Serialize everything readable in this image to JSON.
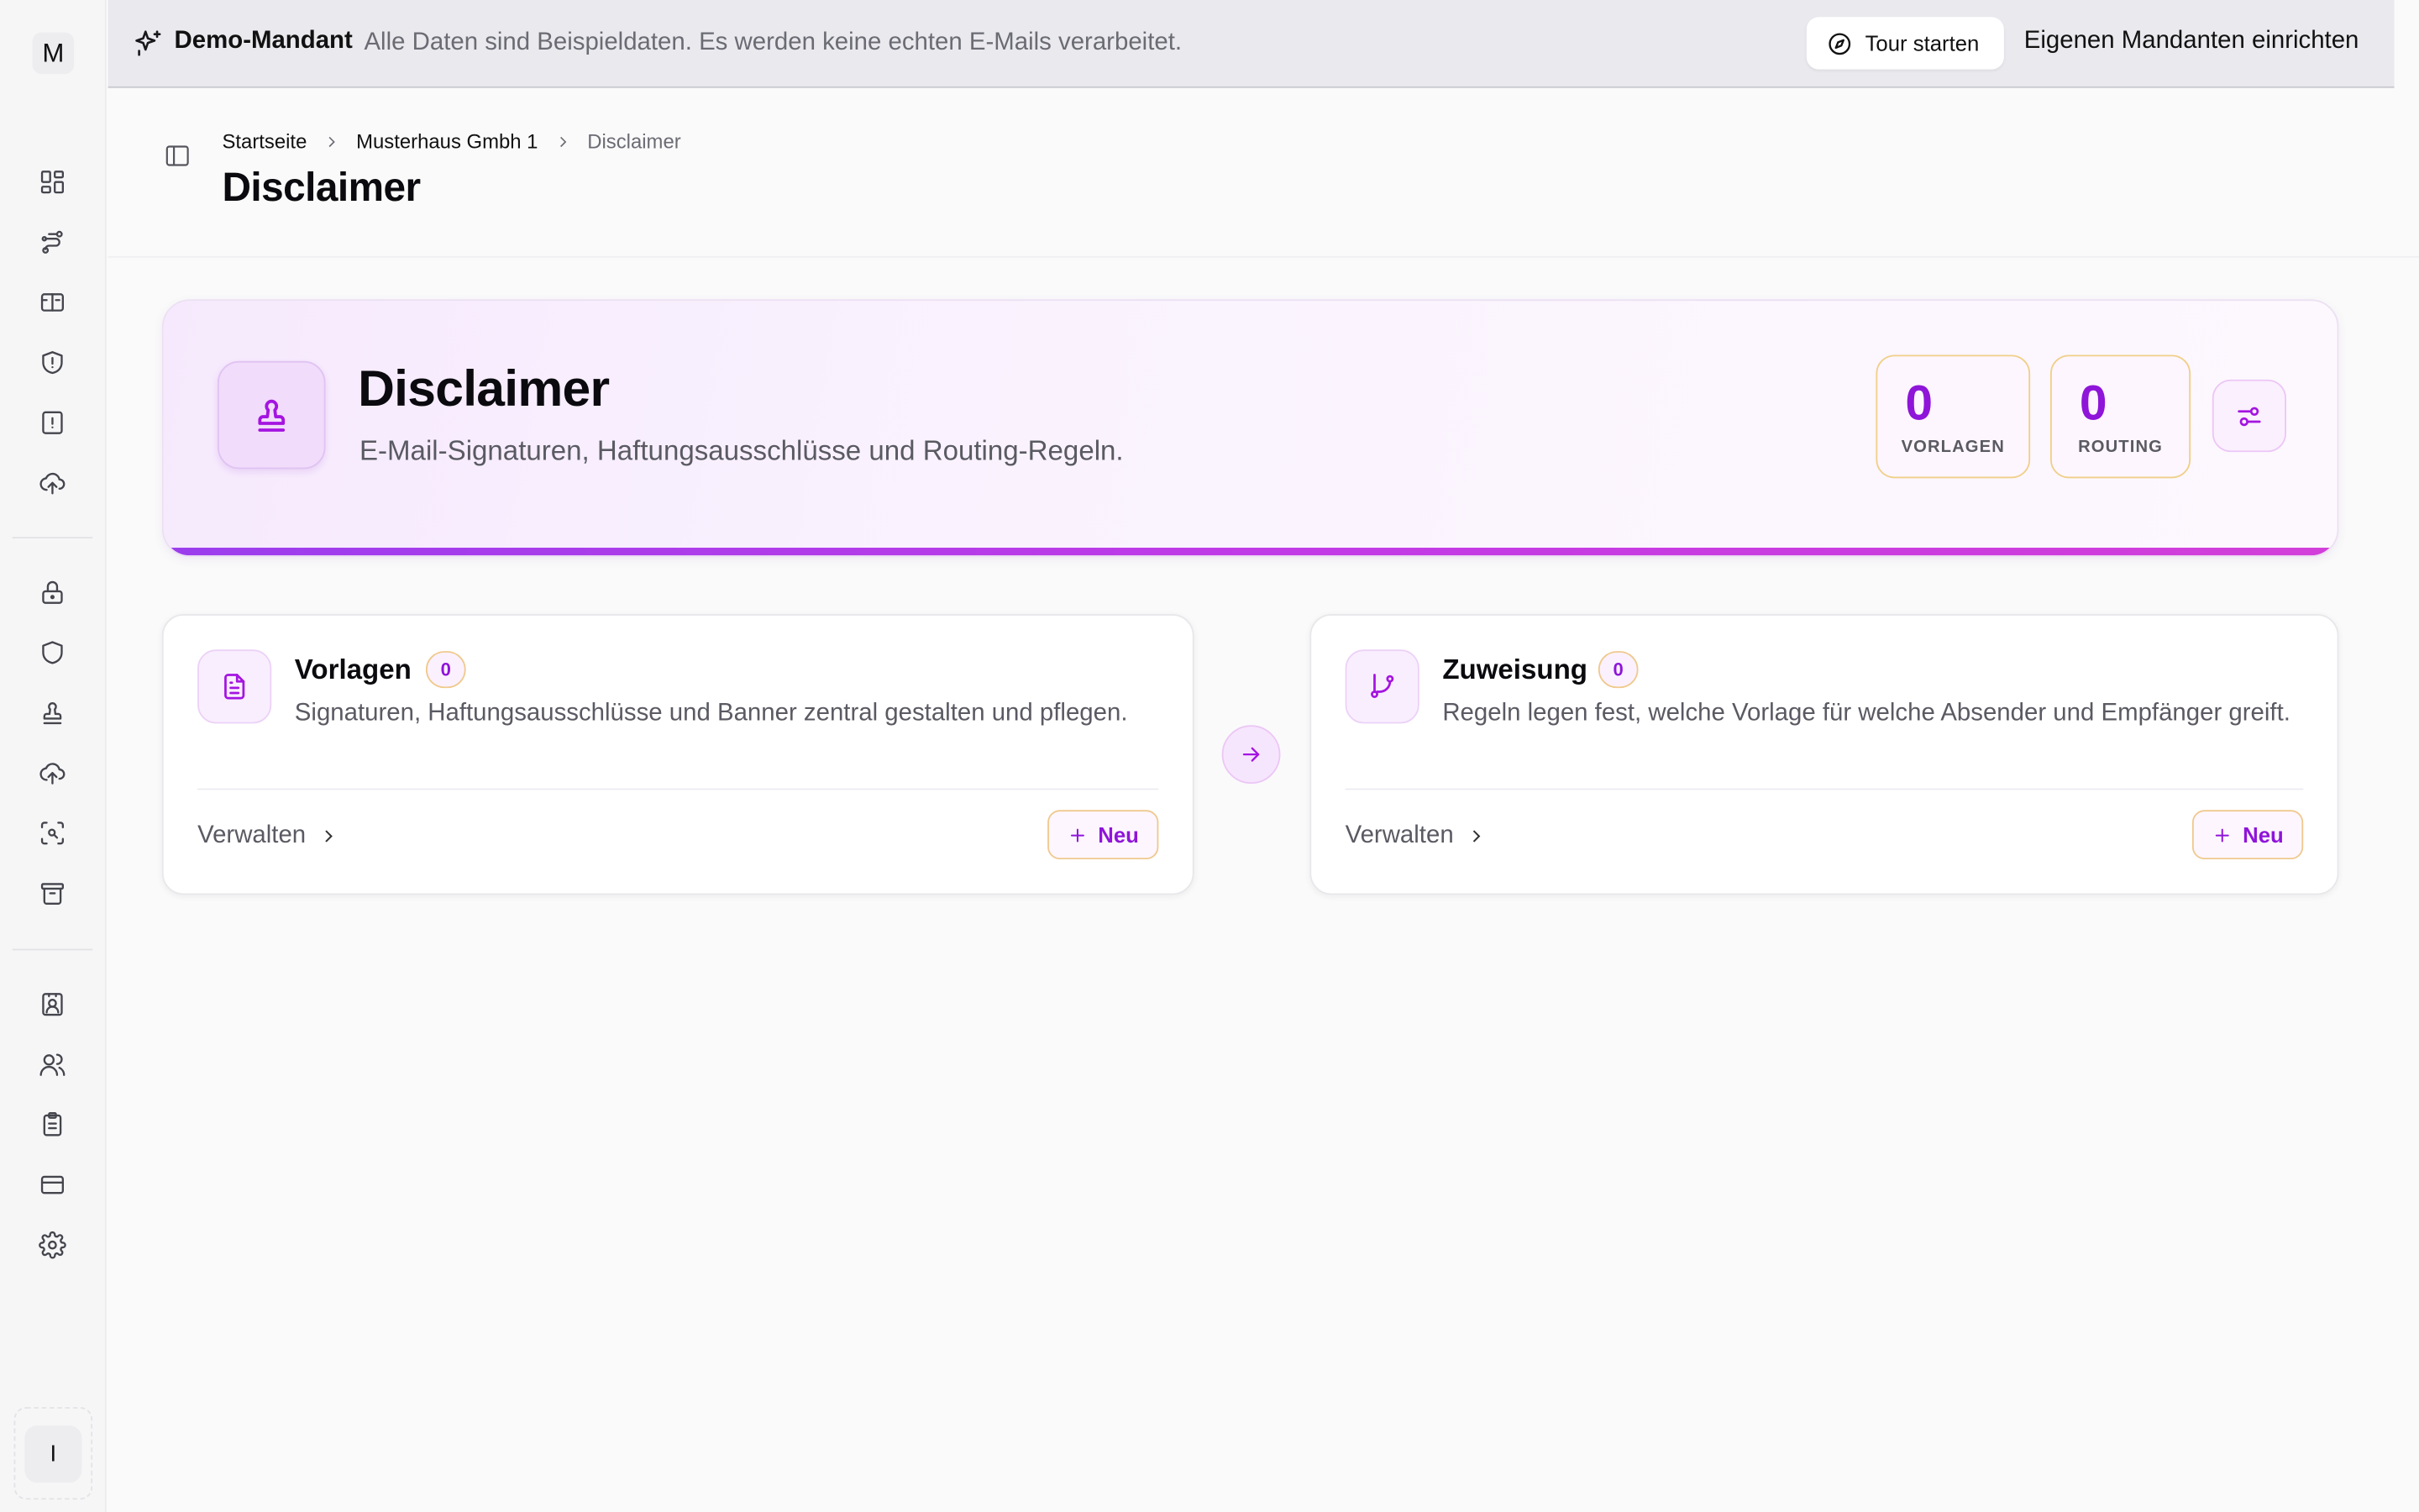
{
  "sidebar": {
    "logo_letter": "M",
    "user_initial": "I",
    "items": [
      {
        "icon": "dashboard-icon"
      },
      {
        "icon": "route-icon"
      },
      {
        "icon": "ticket-icon"
      },
      {
        "icon": "shield-alert-icon"
      },
      {
        "icon": "file-alert-icon"
      },
      {
        "icon": "cloud-upload-icon"
      },
      {
        "icon": "lock-icon"
      },
      {
        "icon": "shield-icon"
      },
      {
        "icon": "stamp-icon"
      },
      {
        "icon": "cloud-upload-icon"
      },
      {
        "icon": "scan-search-icon"
      },
      {
        "icon": "archive-icon"
      },
      {
        "icon": "contact-icon"
      },
      {
        "icon": "users-icon"
      },
      {
        "icon": "clipboard-icon"
      },
      {
        "icon": "credit-card-icon"
      },
      {
        "icon": "gear-icon"
      }
    ]
  },
  "banner": {
    "tenant": "Demo-Mandant",
    "note": "Alle Daten sind Beispieldaten. Es werden keine echten E-Mails verarbeitet.",
    "tour_label": "Tour starten",
    "own_tenant_label": "Eigenen Mandanten einrichten"
  },
  "breadcrumb": {
    "home": "Startseite",
    "tenant": "Musterhaus Gmbh 1",
    "current": "Disclaimer"
  },
  "page_title": "Disclaimer",
  "hero": {
    "title": "Disclaimer",
    "subtitle": "E-Mail-Signaturen, Haftungsausschlüsse und Routing-Regeln.",
    "stats": [
      {
        "value": "0",
        "label": "VORLAGEN"
      },
      {
        "value": "0",
        "label": "ROUTING"
      }
    ]
  },
  "cards": {
    "templates": {
      "title": "Vorlagen",
      "count": "0",
      "description": "Signaturen, Haftungsausschlüsse und Banner zentral gestalten und pflegen.",
      "manage_label": "Verwalten",
      "new_label": "Neu"
    },
    "assignment": {
      "title": "Zuweisung",
      "count": "0",
      "description": "Regeln legen fest, welche Vorlage für welche Absender und Empfänger greift.",
      "manage_label": "Verwalten",
      "new_label": "Neu"
    }
  },
  "colors": {
    "accent": "#a414e0",
    "accent_text": "#8f15d9",
    "badge_border": "#f0c98e",
    "hero_bar": "#c03ae6"
  }
}
